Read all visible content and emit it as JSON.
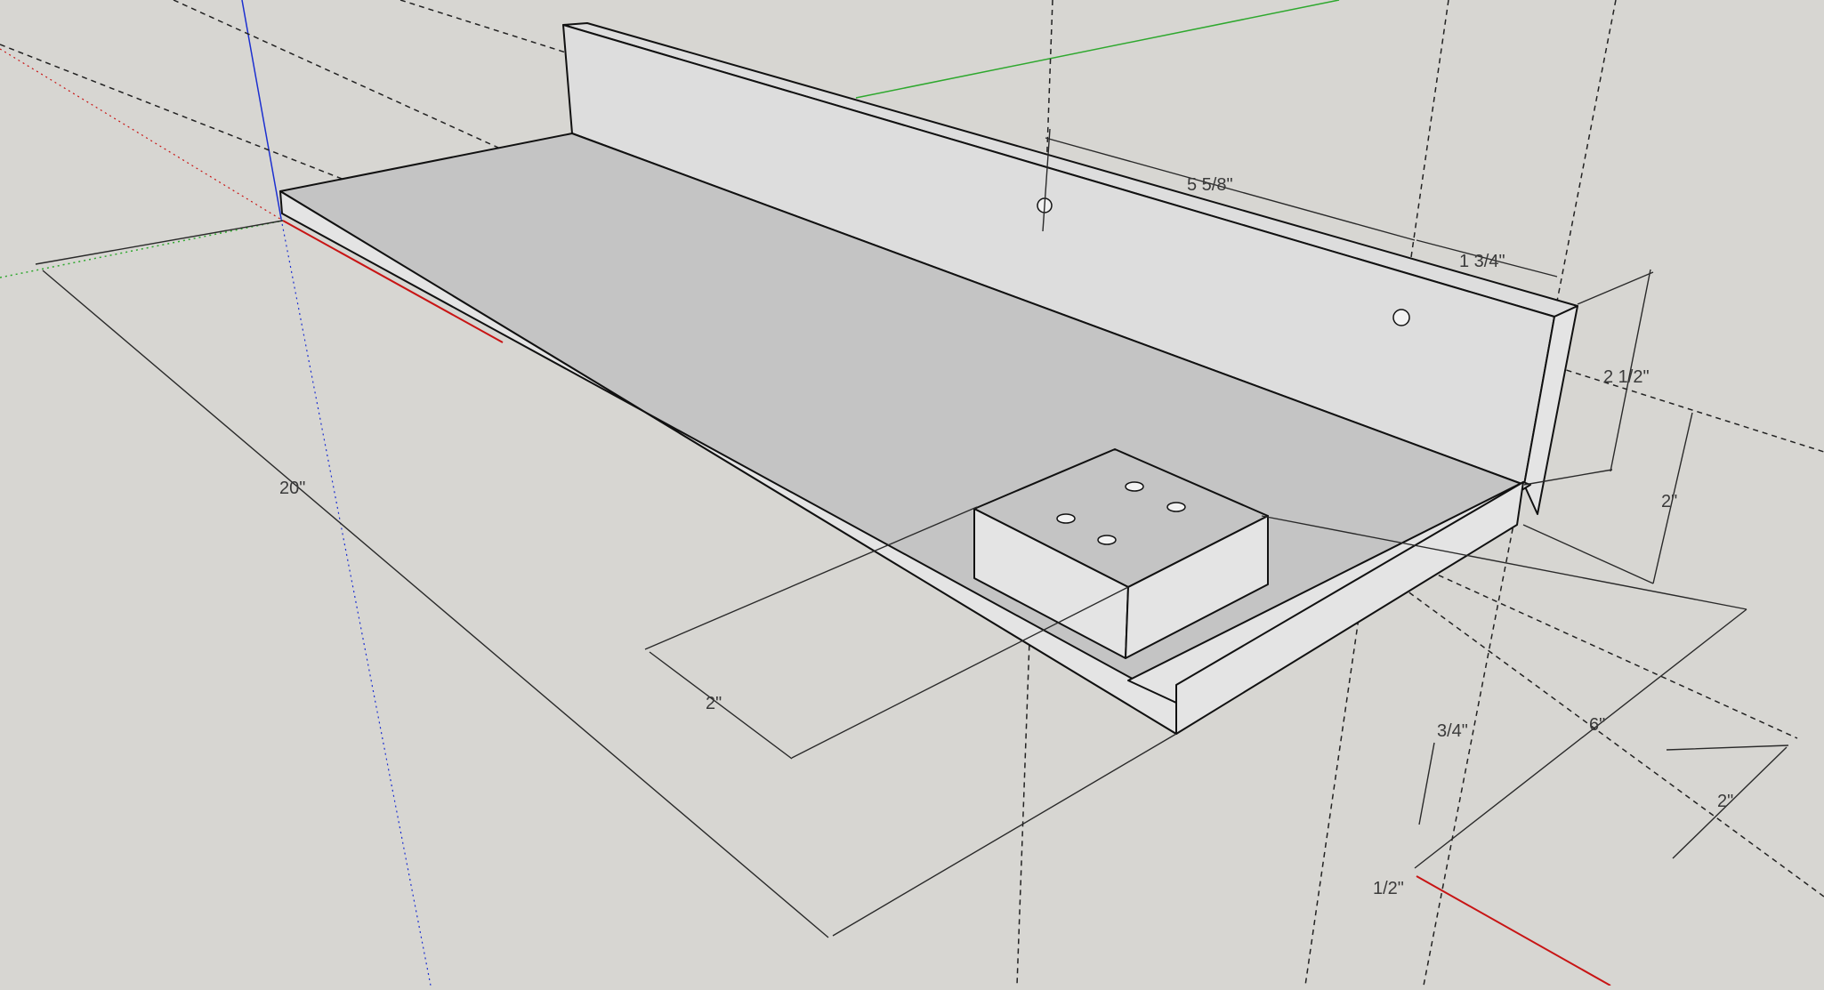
{
  "model": {
    "colors": {
      "background": "#d7d6d2",
      "face_top": "#c4c4c4",
      "face_light": "#e4e4e4",
      "face_back": "#dddddd",
      "edge": "#111111",
      "axis_red": "#c81414",
      "axis_green": "#2ea82e",
      "axis_blue": "#1c2fd0",
      "dimension": "#2a2a2a",
      "guide": "#222222"
    },
    "parts": [
      {
        "name": "base-board",
        "label": "base board"
      },
      {
        "name": "back-fence",
        "label": "back fence"
      },
      {
        "name": "front-lip",
        "label": "front lip"
      },
      {
        "name": "stop-block",
        "label": "stop block"
      }
    ],
    "holes": {
      "fence_holes": 2,
      "block_holes": 4
    }
  },
  "dimensions": {
    "overall_length": "20\"",
    "fence_hole_spacing": "5 5/8\"",
    "fence_hole_edge": "1 3/4\"",
    "fence_height": "2 1/2\"",
    "fence_hole_height": "2\"",
    "block_width": "2\"",
    "base_depth": "6\"",
    "base_thickness": "3/4\"",
    "lip_height": "1/2\"",
    "front_offset": "2\""
  }
}
